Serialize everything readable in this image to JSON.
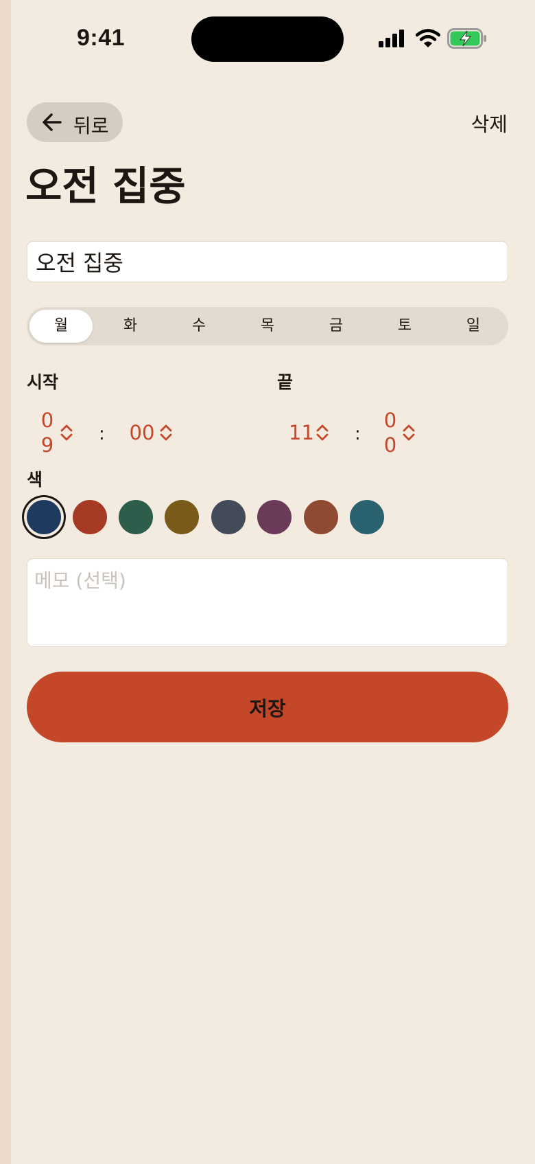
{
  "status_bar": {
    "time": "9:41",
    "icons": [
      "signal-icon",
      "wifi-icon",
      "battery-charging-icon"
    ],
    "battery_color": "#34c759"
  },
  "header": {
    "back_label": "뒤로",
    "delete_label": "삭제"
  },
  "title": "오전 집중",
  "name_field": {
    "value": "오전 집중"
  },
  "days": [
    {
      "label": "월",
      "selected": true
    },
    {
      "label": "화",
      "selected": false
    },
    {
      "label": "수",
      "selected": false
    },
    {
      "label": "목",
      "selected": false
    },
    {
      "label": "금",
      "selected": false
    },
    {
      "label": "토",
      "selected": false
    },
    {
      "label": "일",
      "selected": false
    }
  ],
  "start": {
    "label": "시작",
    "hour_top": "0",
    "hour_bottom": "9",
    "minute": "00",
    "separator": ":"
  },
  "end": {
    "label": "끝",
    "hour": "11",
    "minute_top": "0",
    "minute_bottom": "0",
    "separator": ":"
  },
  "color_section": {
    "label": "색",
    "swatches": [
      "#1e3a5f",
      "#a63a24",
      "#2d5e4c",
      "#7a5a18",
      "#424b57",
      "#6b3a58",
      "#8f4a32",
      "#2b6270"
    ],
    "selected_index": 0
  },
  "memo": {
    "placeholder": "메모 (선택)",
    "value": ""
  },
  "save_label": "저장",
  "colors": {
    "accent": "#c4472a",
    "background": "#f3ebdf",
    "text": "#1c1712"
  }
}
